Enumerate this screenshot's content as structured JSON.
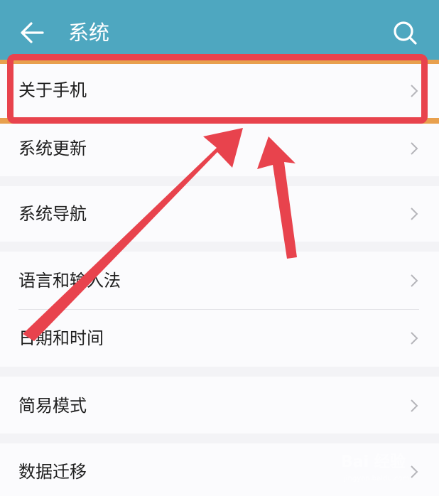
{
  "header": {
    "title": "系统",
    "back_icon": "arrow-left-icon",
    "search_icon": "search-icon",
    "color": "#4ea7c0"
  },
  "items": [
    {
      "label": "关于手机"
    },
    {
      "label": "系统更新"
    },
    {
      "label": "系统导航"
    },
    {
      "label": "语言和输入法"
    },
    {
      "label": "日期和时间"
    },
    {
      "label": "简易模式"
    },
    {
      "label": "数据迁移"
    }
  ],
  "annotation": {
    "highlight_color": "#e8434d"
  },
  "watermark": {
    "text": "Bai 经验",
    "sub": "jingyan.baidu.com"
  }
}
